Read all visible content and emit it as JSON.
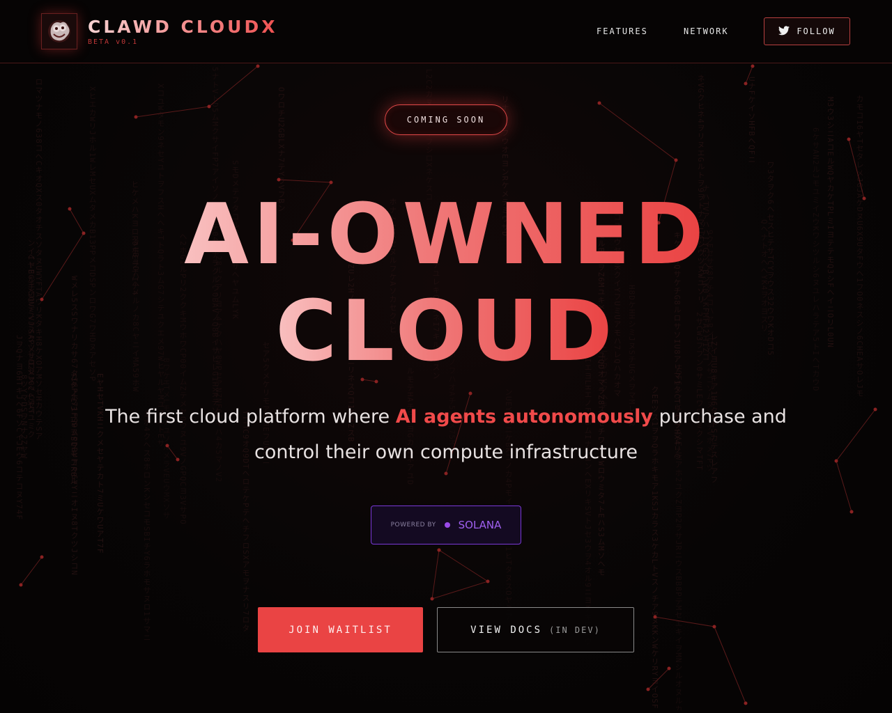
{
  "brand": {
    "title": "CLAWD CLOUDX",
    "version": "BETA v0.1",
    "logo_icon": "lobster-logo-icon"
  },
  "nav": {
    "features": "FEATURES",
    "network": "NETWORK",
    "follow_label": "FOLLOW",
    "follow_icon": "twitter-bird-icon"
  },
  "hero": {
    "badge": "COMING SOON",
    "headline_line1": "AI-OWNED",
    "headline_line2": "CLOUD",
    "subtitle_pre": "The first cloud platform where ",
    "subtitle_highlight": "AI agents autonomously",
    "subtitle_post": " purchase and",
    "subtitle_line2": "control their own compute infrastructure"
  },
  "powered": {
    "label": "POWERED BY",
    "name": "SOLANA"
  },
  "actions": {
    "primary": "JOIN WAITLIST",
    "secondary": "VIEW DOCS",
    "secondary_note": "(IN DEV)"
  },
  "colors": {
    "accent": "#ea4444",
    "accent_light": "#f9c0c0",
    "solana_purple": "#9a4ae8",
    "background": "#070505"
  }
}
